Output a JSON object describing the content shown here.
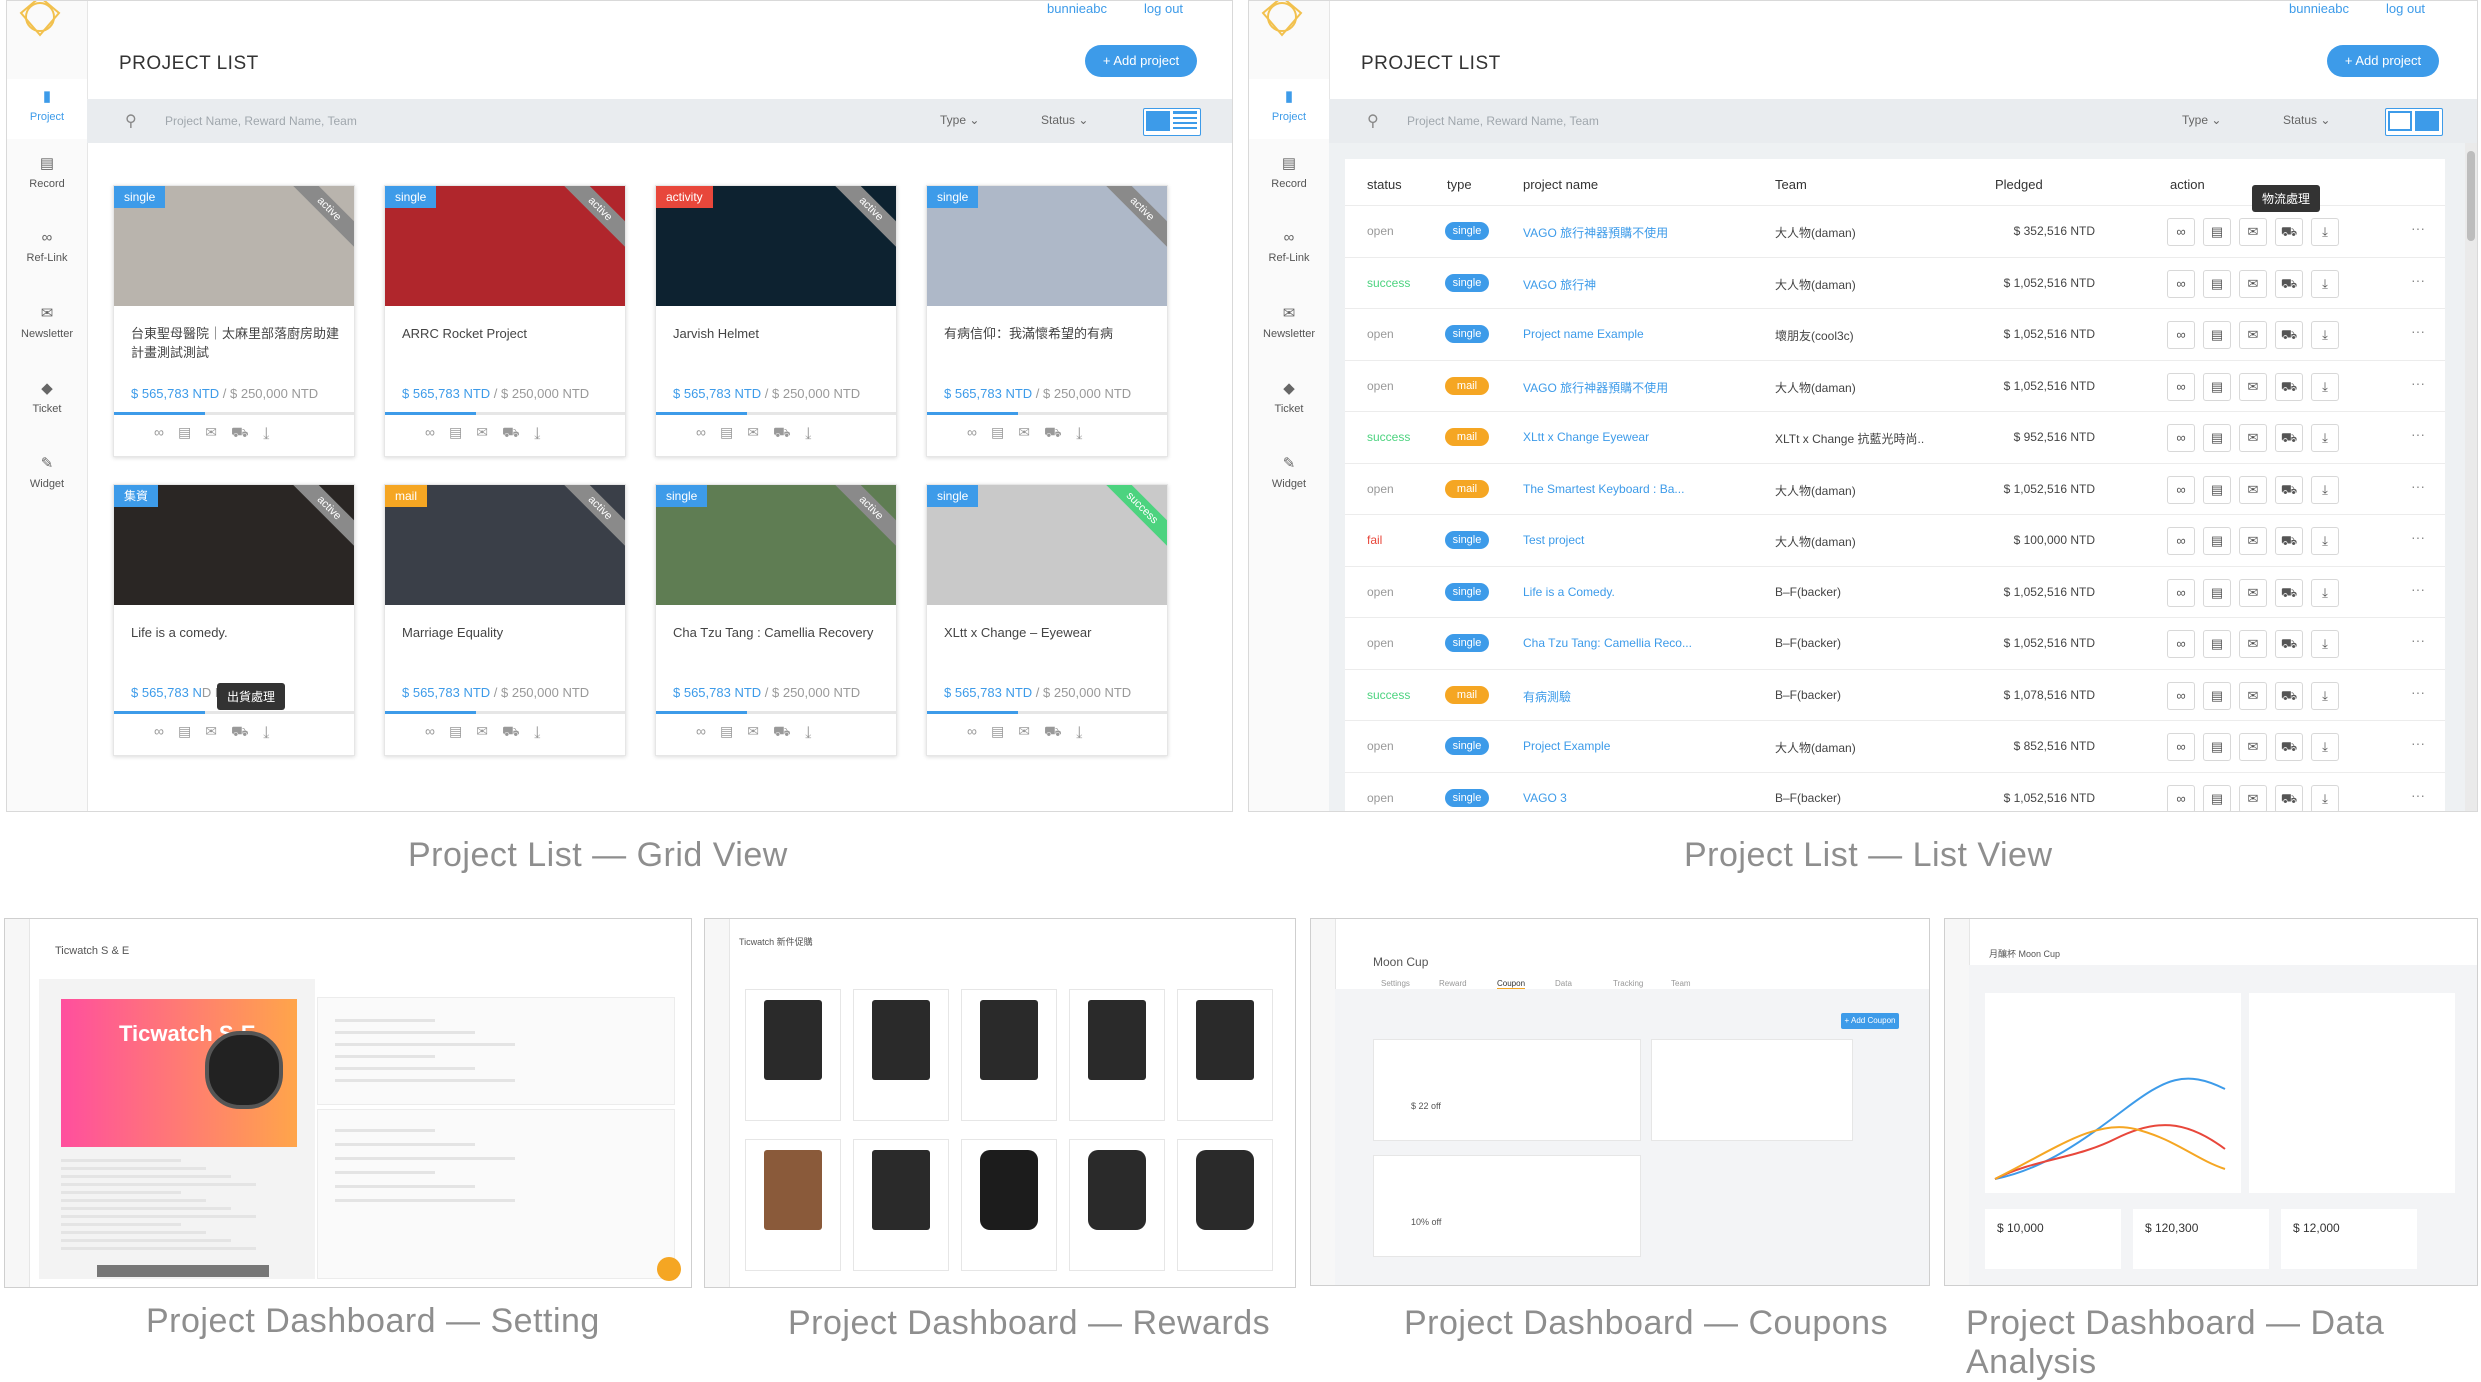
{
  "user": {
    "name": "bunnieabc",
    "logout": "log out"
  },
  "sidebar": [
    {
      "label": "Project",
      "icon": "book-icon"
    },
    {
      "label": "Record",
      "icon": "record-icon"
    },
    {
      "label": "Ref-Link",
      "icon": "link-icon"
    },
    {
      "label": "Newsletter",
      "icon": "mail-icon"
    },
    {
      "label": "Ticket",
      "icon": "ticket-icon"
    },
    {
      "label": "Widget",
      "icon": "widget-icon"
    }
  ],
  "page": {
    "title": "PROJECT LIST",
    "add_button": "+ Add project",
    "search_placeholder": "Project Name, Reward Name, Team",
    "type_filter": "Type",
    "status_filter": "Status"
  },
  "cards": [
    {
      "tag": "single",
      "tag_color": "#3d9be9",
      "ribbon": "active",
      "ribbon_color": "#8a8a8a",
      "name": "台東聖母醫院｜太麻里部落廚房助建計畫測試測試",
      "raised": "$ 565,783 NTD",
      "goal": " / $ 250,000 NTD",
      "progress": 0.38,
      "img": "#b9b4ad"
    },
    {
      "tag": "single",
      "tag_color": "#3d9be9",
      "ribbon": "active",
      "ribbon_color": "#8a8a8a",
      "name": "ARRC Rocket Project",
      "raised": "$ 565,783 NTD",
      "goal": " / $ 250,000 NTD",
      "progress": 0.38,
      "img": "#b0262c"
    },
    {
      "tag": "activity",
      "tag_color": "#e8473b",
      "ribbon": "active",
      "ribbon_color": "#8a8a8a",
      "name": "Jarvish Helmet",
      "raised": "$ 565,783 NTD",
      "goal": " / $ 250,000 NTD",
      "progress": 0.38,
      "img": "#0d2230"
    },
    {
      "tag": "single",
      "tag_color": "#3d9be9",
      "ribbon": "active",
      "ribbon_color": "#8a8a8a",
      "name": "有病信仰：我滿懷希望的有病",
      "raised": "$ 565,783 NTD",
      "goal": " / $ 250,000 NTD",
      "progress": 0.38,
      "img": "#aeb8c8"
    },
    {
      "tag": "集資",
      "tag_color": "#3d9be9",
      "ribbon": "active",
      "ribbon_color": "#8a8a8a",
      "name": "Life is a comedy.",
      "raised": "$ 565,783 N",
      "goal": "D NTD",
      "progress": 0.38,
      "img": "#2a2624"
    },
    {
      "tag": "mail",
      "tag_color": "#f5a623",
      "ribbon": "active",
      "ribbon_color": "#8a8a8a",
      "name": "Marriage Equality",
      "raised": "$ 565,783 NTD",
      "goal": " / $ 250,000 NTD",
      "progress": 0.38,
      "img": "#3a3f48"
    },
    {
      "tag": "single",
      "tag_color": "#3d9be9",
      "ribbon": "active",
      "ribbon_color": "#8a8a8a",
      "name": "Cha Tzu Tang : Camellia Recovery",
      "raised": "$ 565,783 NTD",
      "goal": " / $ 250,000 NTD",
      "progress": 0.38,
      "img": "#5f7d53"
    },
    {
      "tag": "single",
      "tag_color": "#3d9be9",
      "ribbon": "success",
      "ribbon_color": "#4cd37f",
      "name": "XLtt x Change – Eyewear",
      "raised": "$ 565,783 NTD",
      "goal": " / $ 250,000 NTD",
      "progress": 0.38,
      "img": "#c9c9c9"
    }
  ],
  "grid_tooltip": "出貨處理",
  "list_tooltip": "物流處理",
  "table": {
    "headers": [
      "status",
      "type",
      "project name",
      "Team",
      "Pledged",
      "action"
    ],
    "rows": [
      {
        "status": "open",
        "type": "single",
        "name": "VAGO 旅行神器預購不使用",
        "team": "大人物(daman)",
        "pledged": "$ 352,516 NTD"
      },
      {
        "status": "success",
        "type": "single",
        "name": "VAGO 旅行神",
        "team": "大人物(daman)",
        "pledged": "$ 1,052,516 NTD"
      },
      {
        "status": "open",
        "type": "single",
        "name": "Project name Example",
        "team": "壞朋友(cool3c)",
        "pledged": "$ 1,052,516 NTD"
      },
      {
        "status": "open",
        "type": "mail",
        "name": "VAGO 旅行神器預購不使用",
        "team": "大人物(daman)",
        "pledged": "$ 1,052,516 NTD"
      },
      {
        "status": "success",
        "type": "mail",
        "name": "XLtt x Change Eyewear",
        "team": "XLTt x Change 抗藍光時尚..",
        "pledged": "$ 952,516 NTD"
      },
      {
        "status": "open",
        "type": "mail",
        "name": "The Smartest Keyboard : Ba...",
        "team": "大人物(daman)",
        "pledged": "$ 1,052,516 NTD"
      },
      {
        "status": "fail",
        "type": "single",
        "name": "Test project",
        "team": "大人物(daman)",
        "pledged": "$ 100,000 NTD"
      },
      {
        "status": "open",
        "type": "single",
        "name": "Life is a Comedy.",
        "team": "B–F(backer)",
        "pledged": "$ 1,052,516 NTD"
      },
      {
        "status": "open",
        "type": "single",
        "name": "Cha Tzu Tang: Camellia Reco...",
        "team": "B–F(backer)",
        "pledged": "$ 1,052,516 NTD"
      },
      {
        "status": "success",
        "type": "mail",
        "name": "有病測驗",
        "team": "B–F(backer)",
        "pledged": "$ 1,078,516 NTD"
      },
      {
        "status": "open",
        "type": "single",
        "name": "Project Example",
        "team": "大人物(daman)",
        "pledged": "$ 852,516 NTD"
      },
      {
        "status": "open",
        "type": "single",
        "name": "VAGO 3",
        "team": "B–F(backer)",
        "pledged": "$ 1,052,516 NTD"
      }
    ]
  },
  "captions": {
    "grid": "Project List  —  Grid View",
    "list": "Project List  —  List View",
    "setting": "Project Dashboard  —  Setting",
    "rewards": "Project Dashboard  —  Rewards",
    "coupons": "Project Dashboard  —  Coupons",
    "analysis": "Project Dashboard  —  Data Analysis"
  },
  "thumbs": {
    "setting": {
      "title": "Ticwatch S & E",
      "hero": "Ticwatch S·E"
    },
    "rewards": {
      "title": "Ticwatch 新件促購"
    },
    "coupons": {
      "title": "Moon Cup",
      "tabs": [
        "Settings",
        "Reward",
        "Coupon",
        "Data",
        "Tracking",
        "Team"
      ],
      "coupon1": "$ 22 off",
      "coupon2": "10% off",
      "add": "+ Add Coupon"
    },
    "analysis": {
      "title": "月釀杯 Moon Cup",
      "stats": [
        "$ 10,000",
        "$ 120,300",
        "$ 12,000"
      ]
    }
  },
  "colors": {
    "accent": "#3d9be9",
    "mail": "#f5a623",
    "success": "#4cd37f",
    "fail": "#e8473b"
  }
}
